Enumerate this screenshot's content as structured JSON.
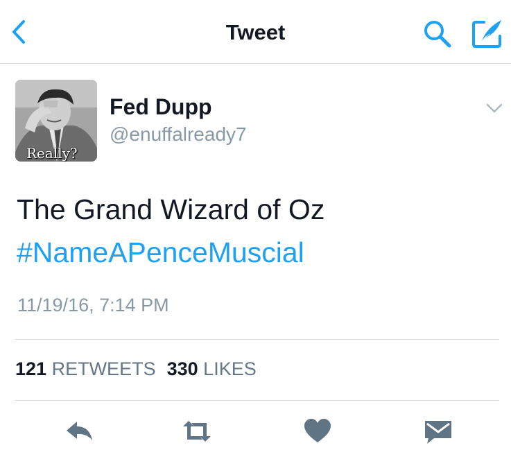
{
  "nav": {
    "title": "Tweet",
    "icons": {
      "back": "chevron-left-icon",
      "search": "search-icon",
      "compose": "compose-tweet-icon"
    }
  },
  "colors": {
    "accent": "#1da1f2",
    "secondary_text": "#8899a6",
    "action_icon": "#5f7585",
    "divider": "#d8d8d8"
  },
  "tweet": {
    "author": {
      "name": "Fed Dupp",
      "handle": "@enuffalready7",
      "avatar_caption": "Really?"
    },
    "text": "The Grand Wizard of Oz",
    "hashtag": "#NameAPenceMuscial",
    "timestamp": "11/19/16, 7:14 PM",
    "stats": {
      "retweets_count": "121",
      "retweets_label": "RETWEETS",
      "likes_count": "330",
      "likes_label": "LIKES"
    }
  },
  "actions": [
    {
      "name": "reply",
      "icon": "reply-icon"
    },
    {
      "name": "retweet",
      "icon": "retweet-icon"
    },
    {
      "name": "like",
      "icon": "heart-icon"
    },
    {
      "name": "direct-message",
      "icon": "envelope-icon"
    }
  ]
}
